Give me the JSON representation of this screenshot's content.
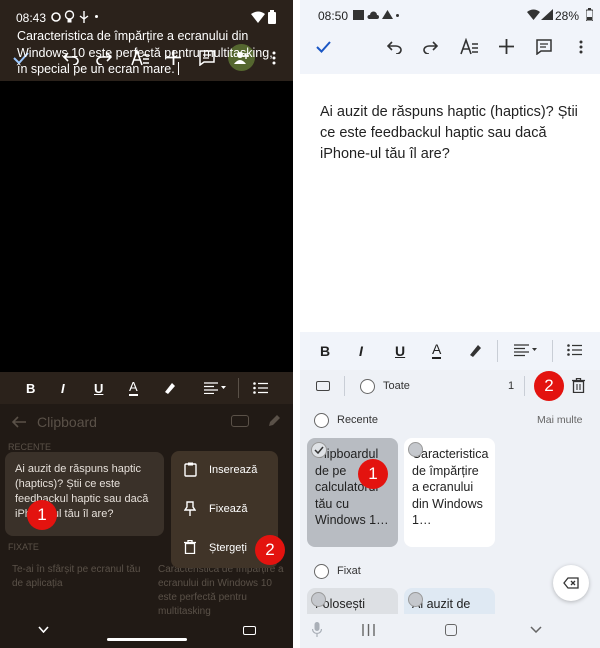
{
  "left": {
    "status": {
      "time": "08:43"
    },
    "doc_text": "Caracteristica de împărțire a ecranului din Windows 10 este perfectă pentru multitasking, în special pe un ecran mare.",
    "clipboard": {
      "title": "Clipboard",
      "recent_label": "RECENTE",
      "pinned_label": "FIXATE",
      "card_text": "Ai auzit de răspuns haptic (haptics)? Știi ce este feedbackul haptic sau dacă iPhone-ul tău îl are?",
      "pinned_1": "Te-ai în sfârșit pe ecranul tău de aplicația",
      "pinned_2": "Caracteristica de împărțire a ecranului din Windows 10 este perfectă pentru multitasking"
    },
    "menu": {
      "insert": "Inserează",
      "pin": "Fixează",
      "delete": "Ștergeți"
    },
    "badges": {
      "one": "1",
      "two": "2"
    },
    "colors": {
      "accent": "#e3130f",
      "toolbar_bg": "#2b221b",
      "share_bg": "#55672f"
    }
  },
  "right": {
    "status": {
      "time": "08:50",
      "battery": "28%"
    },
    "doc_text": "Ai auzit de răspuns haptic (haptics)? Știi ce este feedbackul haptic sau dacă iPhone-ul tău îl are?",
    "select_all_label": "Toate",
    "selected_count": "1",
    "recent_label": "Recente",
    "more_label": "Mai multe",
    "pinned_label": "Fixat",
    "tile_1": "Clipboardul de pe calculatorul tău cu Windows 1…",
    "tile_2": "Caracteristica de împărțire a ecranului din Windows 1…",
    "pinned_tile_1": "Folosești",
    "pinned_tile_2": "Ai auzit de",
    "badges": {
      "one": "1",
      "two": "2"
    }
  }
}
